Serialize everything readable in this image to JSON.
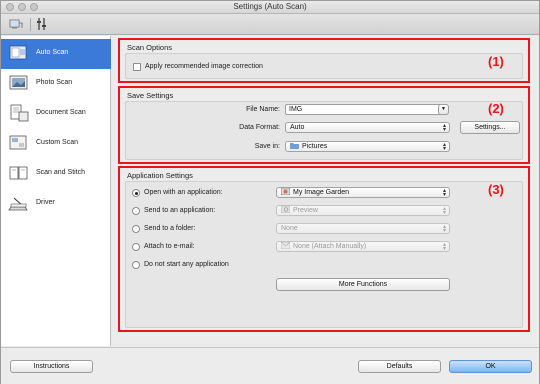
{
  "window": {
    "title": "Settings (Auto Scan)"
  },
  "sidebar": {
    "items": [
      {
        "label": "Auto Scan",
        "icon": "auto-scan-icon",
        "active": true
      },
      {
        "label": "Photo Scan",
        "icon": "photo-scan-icon"
      },
      {
        "label": "Document Scan",
        "icon": "document-scan-icon"
      },
      {
        "label": "Custom Scan",
        "icon": "custom-scan-icon"
      },
      {
        "label": "Scan and Stitch",
        "icon": "scan-stitch-icon"
      },
      {
        "label": "Driver",
        "icon": "driver-icon"
      }
    ]
  },
  "scan_options": {
    "title": "Scan Options",
    "marker": "(1)",
    "apply_correction_label": "Apply recommended image correction"
  },
  "save_settings": {
    "title": "Save Settings",
    "marker": "(2)",
    "file_name_label": "File Name:",
    "file_name_value": "IMG",
    "data_format_label": "Data Format:",
    "data_format_value": "Auto",
    "settings_button": "Settings...",
    "save_in_label": "Save in:",
    "save_in_value": "Pictures"
  },
  "app_settings": {
    "title": "Application Settings",
    "marker": "(3)",
    "options": [
      {
        "label": "Open with an application:",
        "value": "My Image Garden",
        "selected": true,
        "enabled": true
      },
      {
        "label": "Send to an application:",
        "value": "Preview",
        "selected": false,
        "enabled": false
      },
      {
        "label": "Send to a folder:",
        "value": "None",
        "selected": false,
        "enabled": false
      },
      {
        "label": "Attach to e-mail:",
        "value": "None (Attach Manually)",
        "selected": false,
        "enabled": false
      },
      {
        "label": "Do not start any application",
        "selected": false
      }
    ],
    "more_functions": "More Functions"
  },
  "footer": {
    "instructions": "Instructions",
    "defaults": "Defaults",
    "ok": "OK"
  },
  "colors": {
    "highlight": "#e8161b",
    "selection": "#3b7ad9"
  }
}
